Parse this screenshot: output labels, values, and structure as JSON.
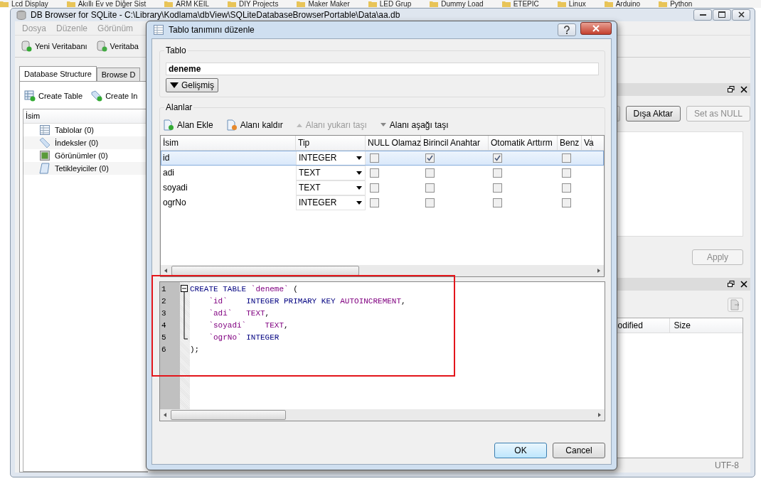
{
  "bookmarks": [
    "Lcd Display",
    "Akıllı Ev ve Diğer Sist",
    "ARM KEIL",
    "DIY Projects",
    "Maker Maker",
    "LED Grup",
    "Dummy Load",
    "ETEPIC",
    "Linux",
    "Arduino",
    "Python"
  ],
  "main_window": {
    "title": "DB Browser for SQLite - C:\\Library\\Kodlama\\dbView\\SQLiteDatabaseBrowserPortable\\Data\\aa.db",
    "menu": [
      "Dosya",
      "Düzenle",
      "Görünüm"
    ],
    "toolbar": [
      "Yeni Veritabanı",
      "Veritaba"
    ],
    "tabs": [
      {
        "label": "Database Structure",
        "selected": true
      },
      {
        "label": "Browse D",
        "selected": false
      }
    ],
    "actions": [
      "Create Table",
      "Create In"
    ],
    "tree": {
      "header": "İsim",
      "items": [
        {
          "label": "Tablolar (0)",
          "kind": "table"
        },
        {
          "label": "İndeksler (0)",
          "kind": "index"
        },
        {
          "label": "Görünümler (0)",
          "kind": "view"
        },
        {
          "label": "Tetikleyiciler (0)",
          "kind": "trigger"
        }
      ]
    },
    "edit_dock": {
      "buttons": [
        {
          "label": "Dışa Aktar",
          "disabled": false
        },
        {
          "label": "Set as NULL",
          "disabled": true
        }
      ],
      "apply": {
        "label": "Apply",
        "disabled": true
      }
    },
    "files_dock": {
      "columns": [
        "odified",
        "Size"
      ]
    },
    "status": "UTF-8"
  },
  "dialog": {
    "title": "Tablo tanımını düzenle",
    "table_group": {
      "label": "Tablo",
      "name": "deneme",
      "advanced": "Gelişmiş"
    },
    "fields_group": {
      "label": "Alanlar",
      "actions": [
        {
          "label": "Alan Ekle",
          "kind": "add",
          "disabled": false
        },
        {
          "label": "Alanı kaldır",
          "kind": "remove",
          "disabled": false
        },
        {
          "label": "Alanı yukarı taşı",
          "kind": "up",
          "disabled": true
        },
        {
          "label": "Alanı aşağı taşı",
          "kind": "down",
          "disabled": false
        }
      ],
      "columns": [
        "İsim",
        "Tip",
        "NULL Olamaz",
        "Birincil Anahtar",
        "Otomatik Arttırm",
        "Benz",
        "Va"
      ],
      "rows": [
        {
          "name": "id",
          "type": "INTEGER",
          "not_null": false,
          "primary_key": true,
          "autoincrement": true,
          "unique": false,
          "selected": true
        },
        {
          "name": "adi",
          "type": "TEXT",
          "not_null": false,
          "primary_key": false,
          "autoincrement": false,
          "unique": false,
          "selected": false
        },
        {
          "name": "soyadi",
          "type": "TEXT",
          "not_null": false,
          "primary_key": false,
          "autoincrement": false,
          "unique": false,
          "selected": false
        },
        {
          "name": "ogrNo",
          "type": "INTEGER",
          "not_null": false,
          "primary_key": false,
          "autoincrement": false,
          "unique": false,
          "selected": false
        }
      ]
    },
    "sql": {
      "highlighted": true,
      "lines": [
        {
          "number": "1",
          "indent": false,
          "tokens": [
            {
              "text": "CREATE TABLE ",
              "kind": "keyword"
            },
            {
              "text": "`deneme`",
              "kind": "identifier"
            },
            {
              "text": " (",
              "kind": "plain"
            }
          ]
        },
        {
          "number": "2",
          "indent": true,
          "tokens": [
            {
              "text": "`id`    ",
              "kind": "identifier"
            },
            {
              "text": "INTEGER PRIMARY KEY ",
              "kind": "keyword"
            },
            {
              "text": "AUTOINCREMENT",
              "kind": "identifier"
            },
            {
              "text": ",",
              "kind": "plain"
            }
          ]
        },
        {
          "number": "3",
          "indent": true,
          "tokens": [
            {
              "text": "`adi`   ",
              "kind": "identifier"
            },
            {
              "text": "TEXT",
              "kind": "identifier"
            },
            {
              "text": ",",
              "kind": "plain"
            }
          ]
        },
        {
          "number": "4",
          "indent": true,
          "tokens": [
            {
              "text": "`soyadi`    ",
              "kind": "identifier"
            },
            {
              "text": "TEXT",
              "kind": "identifier"
            },
            {
              "text": ",",
              "kind": "plain"
            }
          ]
        },
        {
          "number": "5",
          "indent": true,
          "tokens": [
            {
              "text": "`ogrNo` ",
              "kind": "identifier"
            },
            {
              "text": "INTEGER",
              "kind": "keyword"
            }
          ]
        },
        {
          "number": "6",
          "indent": false,
          "tokens": [
            {
              "text": ");",
              "kind": "plain"
            }
          ]
        }
      ]
    },
    "buttons": [
      "OK",
      "Cancel"
    ]
  }
}
